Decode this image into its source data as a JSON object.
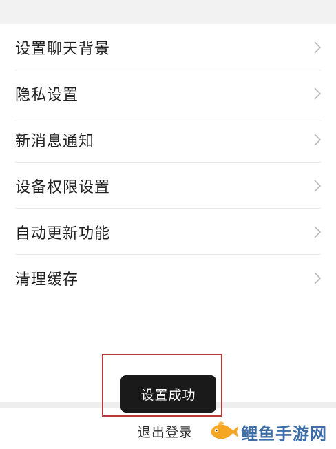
{
  "settings_list": [
    {
      "label": "设置聊天背景"
    },
    {
      "label": "隐私设置"
    },
    {
      "label": "新消息通知"
    },
    {
      "label": "设备权限设置"
    },
    {
      "label": "自动更新功能"
    },
    {
      "label": "清理缓存"
    }
  ],
  "toast": {
    "text": "设置成功"
  },
  "logout": {
    "label": "退出登录"
  },
  "watermark": {
    "text": "鲤鱼手游网"
  },
  "colors": {
    "highlight_border": "#b53a3a",
    "toast_bg": "#1a1a1a",
    "watermark_text": "#3d6ea8",
    "fish_orange": "#f5a623"
  },
  "icons": {
    "row_chevron": "chevron-right-icon",
    "watermark_logo": "fish-icon"
  }
}
